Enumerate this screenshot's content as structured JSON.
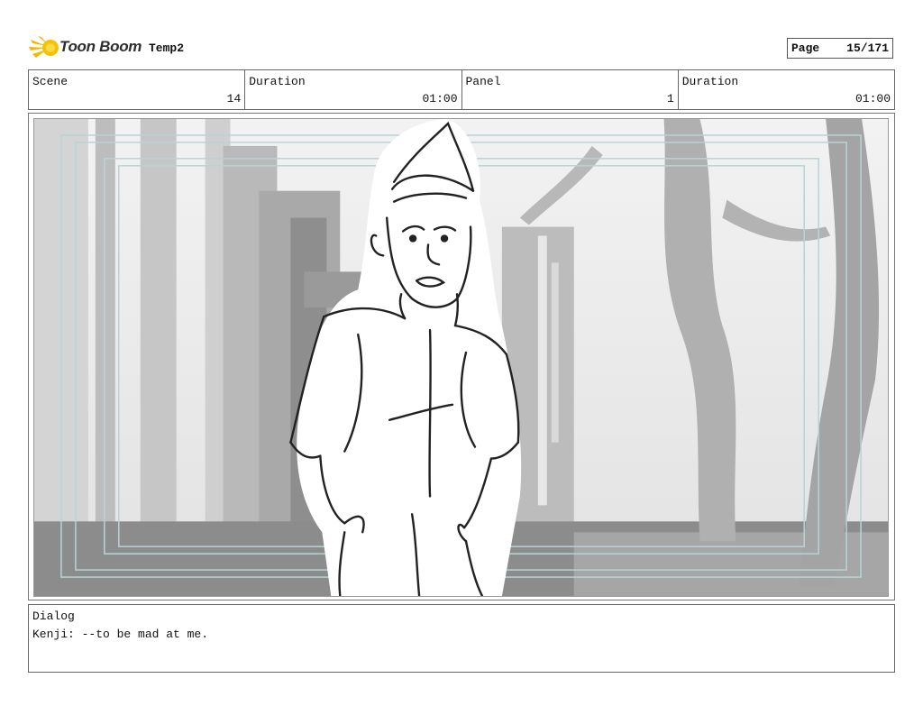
{
  "header": {
    "logo_text": "Toon Boom",
    "project": "Temp2",
    "page_label": "Page",
    "page_value": "15/171"
  },
  "info": {
    "scene_label": "Scene",
    "scene_value": "14",
    "duration1_label": "Duration",
    "duration1_value": "01:00",
    "panel_label": "Panel",
    "panel_value": "1",
    "duration2_label": "Duration",
    "duration2_value": "01:00"
  },
  "panel_image": {
    "description_icon": "storyboard-sketch"
  },
  "dialog": {
    "label": "Dialog",
    "text": "Kenji: --to be mad at me."
  }
}
